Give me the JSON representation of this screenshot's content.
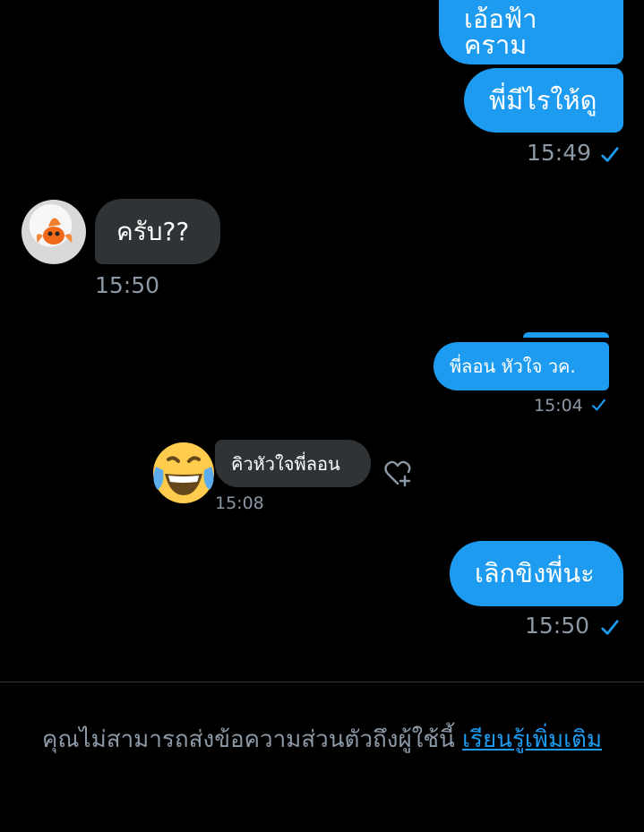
{
  "messages": [
    {
      "id": "m1",
      "text": "เอ้อฟ้าคราม"
    },
    {
      "id": "m2",
      "text": "พี่มีไรให้ดู"
    },
    {
      "id": "t1",
      "text": "15:49"
    },
    {
      "id": "m3",
      "text": "ครับ??"
    },
    {
      "id": "t2",
      "text": "15:50"
    },
    {
      "id": "shared_out",
      "text": "พี่ลอน หัวใจ วค."
    },
    {
      "id": "t3",
      "text": "15:04"
    },
    {
      "id": "shared_in",
      "text": "คิวหัวใจพี่ลอน"
    },
    {
      "id": "t4",
      "text": "15:08"
    },
    {
      "id": "m4",
      "text": "เลิกขิงพี่นะ"
    },
    {
      "id": "t5",
      "text": "15:50"
    }
  ],
  "footer": {
    "text": "คุณไม่สามารถส่งข้อความส่วนตัวถึงผู้ใช้นี้ ",
    "link": "เรียนรู้เพิ่มเติม"
  },
  "colors": {
    "accent": "#1d9bf0",
    "incoming": "#2f3336",
    "muted": "#8b98a5"
  },
  "icons": {
    "read_receipt": "check-icon",
    "reaction": "heart-plus-icon",
    "emoji": "laughing-tears-emoji"
  }
}
